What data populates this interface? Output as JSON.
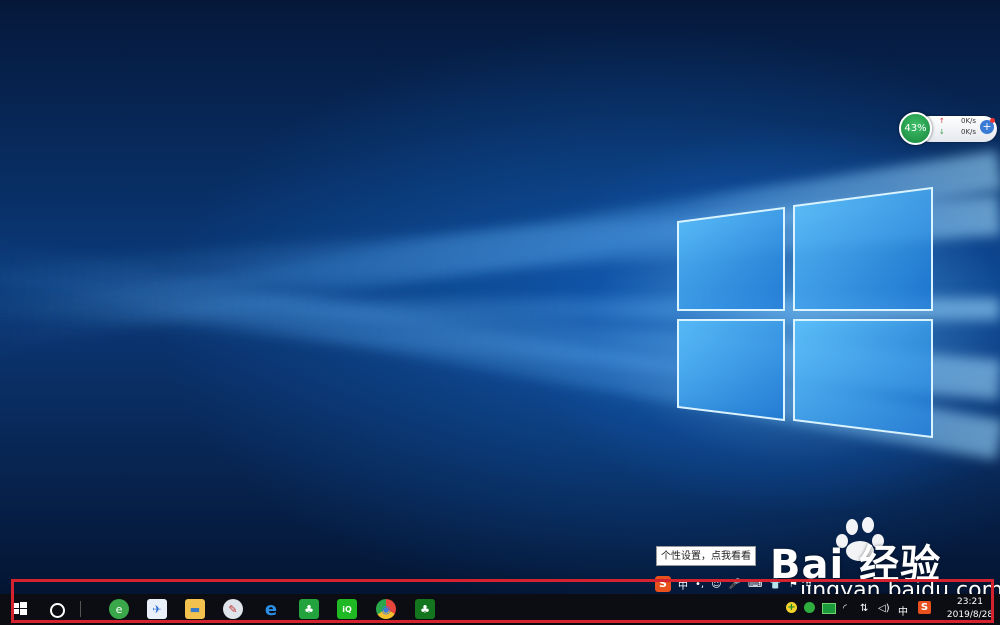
{
  "network_widget": {
    "percent": "43%",
    "upload": "0K/s",
    "download": "0K/s",
    "up_arrow": "↑",
    "down_arrow": "↓",
    "plus": "+"
  },
  "tooltip": {
    "text": "个性设置，点我看看"
  },
  "ime_toolbar": {
    "logo": "S",
    "items": [
      "中",
      "•,",
      "☺",
      "🎤",
      "⌨",
      "👕",
      "⚑",
      "⠿"
    ]
  },
  "watermark": {
    "brand": "Bai 经验",
    "url": "jingyan.baidu.com"
  },
  "taskbar": {
    "apps": [
      {
        "name": "360-browser",
        "glyph": "e",
        "color": "#3aa84a"
      },
      {
        "name": "feishu",
        "glyph": "✈",
        "color": "#e9f0fa"
      },
      {
        "name": "file-explorer",
        "glyph": "▬",
        "color": "#f2c14e"
      },
      {
        "name": "paint",
        "glyph": "✎",
        "color": "#dfe4ea"
      },
      {
        "name": "internet-explorer",
        "glyph": "e",
        "color": "#1d7fd6"
      },
      {
        "name": "wechat-green-app",
        "glyph": "♣",
        "color": "#23a33d"
      },
      {
        "name": "iqiyi",
        "glyph": "iQ",
        "color": "#1fb923"
      },
      {
        "name": "chrome",
        "glyph": "◉",
        "color": "#e8453c"
      },
      {
        "name": "green-app",
        "glyph": "♣",
        "color": "#13761f"
      }
    ],
    "tray": {
      "ime_lang": "中",
      "sogou": "S",
      "clock_time": "23:21",
      "clock_date": "2019/8/28"
    }
  }
}
